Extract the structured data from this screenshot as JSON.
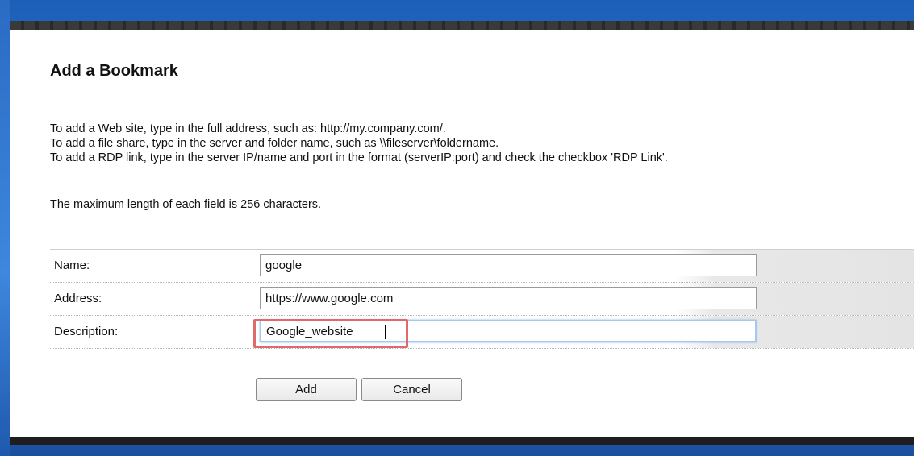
{
  "dialog": {
    "title": "Add a Bookmark",
    "instructions": [
      "To add a Web site, type in the full address, such as: http://my.company.com/.",
      "To add a file share, type in the server and folder name, such as \\\\fileserver\\foldername.",
      "To add a RDP link, type in the server IP/name and port in the format (serverIP:port) and check the checkbox 'RDP Link'."
    ],
    "max_length_note": "The maximum length of each field is 256 characters."
  },
  "form": {
    "name_label": "Name:",
    "name_value": "google",
    "address_label": "Address:",
    "address_value": "https://www.google.com",
    "description_label": "Description:",
    "description_value": "Google_website"
  },
  "buttons": {
    "add_label": "Add",
    "cancel_label": "Cancel"
  },
  "colors": {
    "highlight": "#e06a6a",
    "focus_ring": "#a8c7ee",
    "desktop": "#2f7ad6"
  }
}
